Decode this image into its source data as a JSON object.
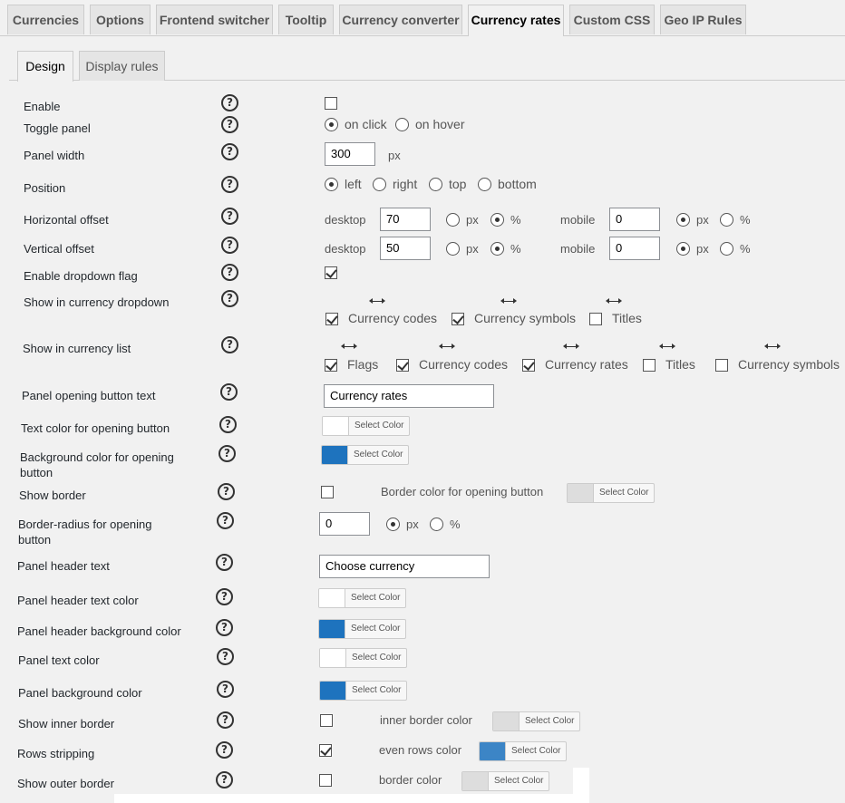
{
  "tabs": [
    "Currencies",
    "Options",
    "Frontend switcher",
    "Tooltip",
    "Currency converter",
    "Currency rates",
    "Custom CSS",
    "Geo IP Rules"
  ],
  "active_tab": "Currency rates",
  "subtabs": [
    "Design",
    "Display rules"
  ],
  "active_subtab": "Design",
  "help_glyph": "?",
  "units": {
    "px": "px",
    "percent": "%"
  },
  "fields": {
    "enable": {
      "label": "Enable",
      "checked": false
    },
    "toggle_panel": {
      "label": "Toggle panel",
      "options": [
        "on click",
        "on hover"
      ],
      "selected": "on click"
    },
    "panel_width": {
      "label": "Panel width",
      "value": "300",
      "unit": "px"
    },
    "position": {
      "label": "Position",
      "options": [
        "left",
        "right",
        "top",
        "bottom"
      ],
      "selected": "left"
    },
    "horizontal_offset": {
      "label": "Horizontal offset",
      "desktop_label": "desktop",
      "desktop_value": "70",
      "desktop_unit": "%",
      "mobile_label": "mobile",
      "mobile_value": "0",
      "mobile_unit": "px"
    },
    "vertical_offset": {
      "label": "Vertical offset",
      "desktop_label": "desktop",
      "desktop_value": "50",
      "desktop_unit": "%",
      "mobile_label": "mobile",
      "mobile_value": "0",
      "mobile_unit": "px"
    },
    "enable_dropdown_flag": {
      "label": "Enable dropdown flag",
      "checked": true
    },
    "show_in_currency_dropdown": {
      "label": "Show in currency dropdown",
      "items": [
        {
          "label": "Currency codes",
          "checked": true
        },
        {
          "label": "Currency symbols",
          "checked": true
        },
        {
          "label": "Titles",
          "checked": false
        }
      ]
    },
    "show_in_currency_list": {
      "label": "Show in currency list",
      "items": [
        {
          "label": "Flags",
          "checked": true
        },
        {
          "label": "Currency codes",
          "checked": true
        },
        {
          "label": "Currency rates",
          "checked": true
        },
        {
          "label": "Titles",
          "checked": false
        },
        {
          "label": "Currency symbols",
          "checked": false
        }
      ]
    },
    "panel_opening_button_text": {
      "label": "Panel opening button text",
      "value": "Currency rates"
    },
    "text_color_opening_button": {
      "label": "Text color for opening button",
      "color": "#ffffff",
      "button": "Select Color"
    },
    "bg_color_opening_button": {
      "label_line1": "Background color for opening",
      "label_line2": "button",
      "color": "#1e73be",
      "button": "Select Color"
    },
    "show_border": {
      "label": "Show border",
      "checked": false,
      "border_color_label": "Border color for opening button",
      "border_color": "#dddddd",
      "button": "Select Color"
    },
    "border_radius": {
      "label_line1": "Border-radius for opening",
      "label_line2": "button",
      "value": "0",
      "unit": "px"
    },
    "panel_header_text": {
      "label": "Panel header text",
      "value": "Choose currency"
    },
    "panel_header_text_color": {
      "label": "Panel header text color",
      "color": "#ffffff",
      "button": "Select Color"
    },
    "panel_header_bg_color": {
      "label": "Panel header background color",
      "color": "#1e73be",
      "button": "Select Color"
    },
    "panel_text_color": {
      "label": "Panel text color",
      "color": "#ffffff",
      "button": "Select Color"
    },
    "panel_bg_color": {
      "label": "Panel background color",
      "color": "#1e73be",
      "button": "Select Color"
    },
    "show_inner_border": {
      "label": "Show inner border",
      "checked": false,
      "color_label": "inner border color",
      "color": "#dddddd",
      "button": "Select Color"
    },
    "rows_stripping": {
      "label": "Rows stripping",
      "checked": true,
      "color_label": "even rows color",
      "color": "#3c85c6",
      "button": "Select Color"
    },
    "show_outer_border": {
      "label": "Show outer border",
      "checked": false,
      "color_label": "border color",
      "color": "#dddddd",
      "button": "Select Color"
    }
  }
}
